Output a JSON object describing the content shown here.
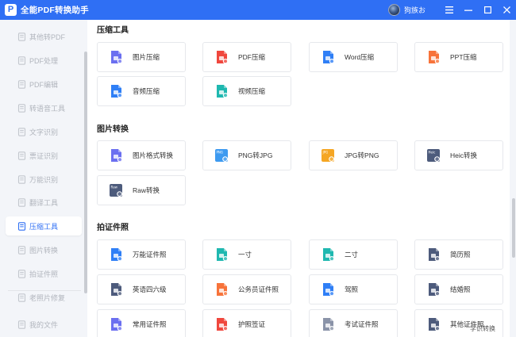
{
  "titlebar": {
    "logo_letter": "P",
    "title": "全能PDF转换助手",
    "username": "狗族お"
  },
  "sidebar": {
    "items": [
      {
        "label": "其他转PDF",
        "icon": "file-convert-icon"
      },
      {
        "label": "PDF处理",
        "icon": "pdf-process-icon"
      },
      {
        "label": "PDF编辑",
        "icon": "pdf-edit-icon"
      },
      {
        "label": "转语音工具",
        "icon": "audio-convert-icon"
      },
      {
        "label": "文字识别",
        "icon": "text-recognition-icon"
      },
      {
        "label": "票证识别",
        "icon": "ticket-recognition-icon"
      },
      {
        "label": "万能识别",
        "icon": "universal-recognition-icon"
      },
      {
        "label": "翻译工具",
        "icon": "translate-icon"
      },
      {
        "label": "压缩工具",
        "icon": "compress-icon",
        "active": true
      },
      {
        "label": "图片转换",
        "icon": "image-convert-icon"
      },
      {
        "label": "拍证件照",
        "icon": "id-photo-icon"
      },
      {
        "label": "老照片修复",
        "icon": "photo-repair-icon"
      },
      {
        "label": "我的文件",
        "icon": "my-files-icon"
      }
    ]
  },
  "sections": [
    {
      "title": "压缩工具",
      "tools": [
        {
          "label": "图片压缩",
          "icon": "image-compress-icon",
          "color": "#6b6ff0"
        },
        {
          "label": "PDF压缩",
          "icon": "pdf-compress-icon",
          "color": "#f0473d"
        },
        {
          "label": "Word压缩",
          "icon": "word-compress-icon",
          "color": "#2f7ff6"
        },
        {
          "label": "PPT压缩",
          "icon": "ppt-compress-icon",
          "color": "#f7733a"
        },
        {
          "label": "音频压缩",
          "icon": "audio-compress-icon",
          "color": "#2f7ff6"
        },
        {
          "label": "视频压缩",
          "icon": "video-compress-icon",
          "color": "#1fb8b0"
        }
      ]
    },
    {
      "title": "图片转换",
      "tools": [
        {
          "label": "图片格式转换",
          "icon": "image-format-icon",
          "color": "#6b6ff0"
        },
        {
          "label": "PNG转JPG",
          "icon": "png-to-jpg-icon",
          "color": "#3d9af0",
          "tag": "PNG"
        },
        {
          "label": "JPG转PNG",
          "icon": "jpg-to-png-icon",
          "color": "#f5a623",
          "tag": "JPG"
        },
        {
          "label": "Heic转换",
          "icon": "heic-convert-icon",
          "color": "#4d5b7c",
          "tag": "Heic"
        },
        {
          "label": "Raw转换",
          "icon": "raw-convert-icon",
          "color": "#4d5b7c",
          "tag": "Raw"
        }
      ]
    },
    {
      "title": "拍证件照",
      "tools": [
        {
          "label": "万能证件照",
          "icon": "universal-id-photo-icon",
          "color": "#2f7ff6"
        },
        {
          "label": "一寸",
          "icon": "one-inch-photo-icon",
          "color": "#1fb8b0"
        },
        {
          "label": "二寸",
          "icon": "two-inch-photo-icon",
          "color": "#1fb8b0"
        },
        {
          "label": "简历照",
          "icon": "resume-photo-icon",
          "color": "#4d5b7c"
        },
        {
          "label": "英语四六级",
          "icon": "cet-photo-icon",
          "color": "#4d5b7c"
        },
        {
          "label": "公务员证件照",
          "icon": "civil-service-photo-icon",
          "color": "#f7733a"
        },
        {
          "label": "驾照",
          "icon": "driver-license-photo-icon",
          "color": "#2f7ff6"
        },
        {
          "label": "结婚照",
          "icon": "wedding-photo-icon",
          "color": "#4d5b7c"
        },
        {
          "label": "常用证件照",
          "icon": "common-id-photo-icon",
          "color": "#6b6ff0"
        },
        {
          "label": "护照签证",
          "icon": "passport-visa-icon",
          "color": "#f0473d"
        },
        {
          "label": "考试证件照",
          "icon": "exam-id-photo-icon",
          "color": "#8a93a8"
        },
        {
          "label": "其他证件照",
          "icon": "other-id-photo-icon",
          "color": "#4d5b7c"
        }
      ]
    }
  ],
  "watermark": "学识转换"
}
